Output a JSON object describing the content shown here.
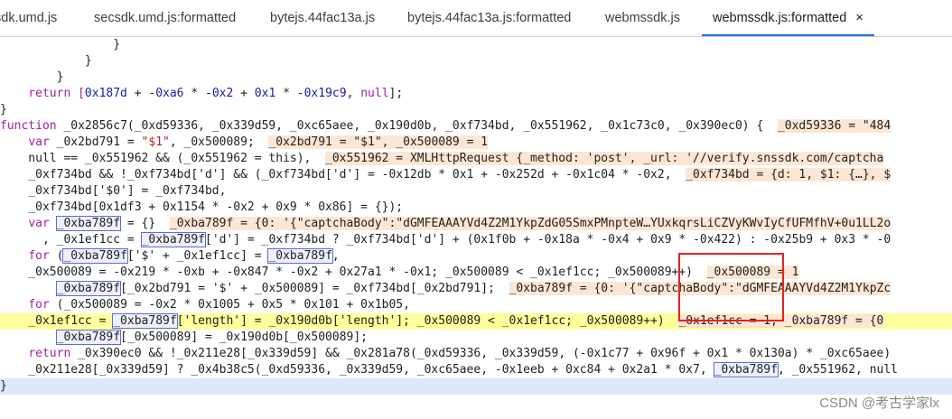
{
  "tabs": [
    {
      "label": "sdk.umd.js",
      "active": false
    },
    {
      "label": "secsdk.umd.js:formatted",
      "active": false
    },
    {
      "label": "bytejs.44fac13a.js",
      "active": false
    },
    {
      "label": "bytejs.44fac13a.js:formatted",
      "active": false
    },
    {
      "label": "webmssdk.js",
      "active": false
    },
    {
      "label": "webmssdk.js:formatted",
      "active": true
    }
  ],
  "close_glyph": "×",
  "code": {
    "l1": "                }",
    "l2": "            }",
    "l3": "        }",
    "l4a": "    return [",
    "l4b": "0x187d",
    "l4c": " + -",
    "l4d": "0xa6",
    "l4e": " * -",
    "l4f": "0x2",
    "l4g": " + ",
    "l4h": "0x1",
    "l4i": " * -",
    "l4j": "0x19c9",
    "l4k": ", ",
    "l4l": "null",
    "l4m": "];",
    "l5": "}",
    "l6a": "function",
    "l6b": " _0x2856c7(_0xd59336, _0x339d59, _0xc65aee, _0x190d0b, _0xf734bd, _0x551962, _0x1c73c0, _0x390ec0) {  ",
    "l6c": "_0xd59336 = \"484",
    "l7a": "    ",
    "l7b": "var",
    "l7c": " _0x2bd791 = ",
    "l7d": "\"$1\"",
    "l7e": ", _0x500089;  ",
    "l7f": "_0x2bd791 = \"$1\", _0x500089 = 1",
    "l8a": "    null == _0x551962 && (_0x551962 = this),  ",
    "l8b": "_0x551962 = XMLHttpRequest {_method: 'post', _url: '//verify.snssdk.com/captcha",
    "l9a": "    _0xf734bd && !_0xf734bd['d'] && (_0xf734bd['d'] = -0x12db * 0x1 + -0x252d + -0x1c04 * -0x2,  ",
    "l9b": "_0xf734bd = {d: 1, $1: {…}, $",
    "l10": "    _0xf734bd['$0'] = _0xf734bd,",
    "l11": "    _0xf734bd[0x1df3 + 0x1154 * -0x2 + 0x9 * 0x86] = {});",
    "l12a": "    ",
    "l12b": "var",
    "l12c": " ",
    "l12d": "_0xba789f",
    "l12e": " = {}  ",
    "l12f": "_0xba789f = {0: '{\"captchaBody\":\"dGMFEAAAYVd4Z2M1YkpZdG05SmxPMnpteW…YUxkqrsLiCZVyKWvIyCfUFMfhV+0u1LL2o",
    "l13a": "      , _0x1ef1cc = ",
    "l13b": "_0xba789f",
    "l13c": "['d'] = _0xf734bd ? _0xf734bd['d'] + (0x1f0b + -0x18a * -0x4 + 0x9 * -0x422) : -0x25b9 + 0x3 * -0",
    "l14a": "    ",
    "l14b": "for",
    "l14c": " (",
    "l14d": "_0xba789f",
    "l14e": "['$' + _0x1ef1cc] = ",
    "l14f": "_0xba789f",
    "l14g": ",",
    "l15a": "    _0x500089 = -0x219 * -0xb + -0x847 * -0x2 + 0x27a1 * -0x1; _0x500089 < _0x1ef1cc; _0x500089++)  ",
    "l15b": "_0x500089 = 1",
    "l16a": "        ",
    "l16b": "_0xba789f",
    "l16c": "[_0x2bd791 = '$' + _0x500089] = _0xf734bd[_0x2bd791];  ",
    "l16d": "_0xba789f = {0: '{\"captchaBody\":\"dGMFEAAAYVd4Z2M1YkpZc",
    "l17a": "    ",
    "l17b": "for",
    "l17c": " (_0x500089 = -0x2 * 0x1005 + 0x5 * 0x101 + 0x1b05,",
    "l18a": "    _0x1ef1cc = ",
    "l18b": "_0xba789f",
    "l18c": "['length'] = _0x190d0b['length']; _0x500089 < _0x1ef1cc; _0x500089++)  ",
    "l18d": "_0x1ef1cc = 1, _0xba789f = {0",
    "l19a": "        ",
    "l19b": "_0xba789f",
    "l19c": "[_0x500089] = _0x190d0b[_0x500089];",
    "l20a": "    ",
    "l20b": "return",
    "l20c": " _0x390ec0 && !_0x211e28[_0x339d59] && _0x281a78(_0xd59336, _0x339d59, (-0x1c77 + 0x96f + 0x1 * 0x130a) * _0xc65aee)",
    "l21a": "    _0x211e28[_0x339d59] ? _0x4b38c5(_0xd59336, _0x339d59, _0xc65aee, -0x1eeb + 0xc84 + 0x2a1 * 0x7, ",
    "l21b": "_0xba789f",
    "l21c": ", _0x551962, null",
    "l22": "}"
  },
  "watermark": "CSDN @考古学家lx"
}
